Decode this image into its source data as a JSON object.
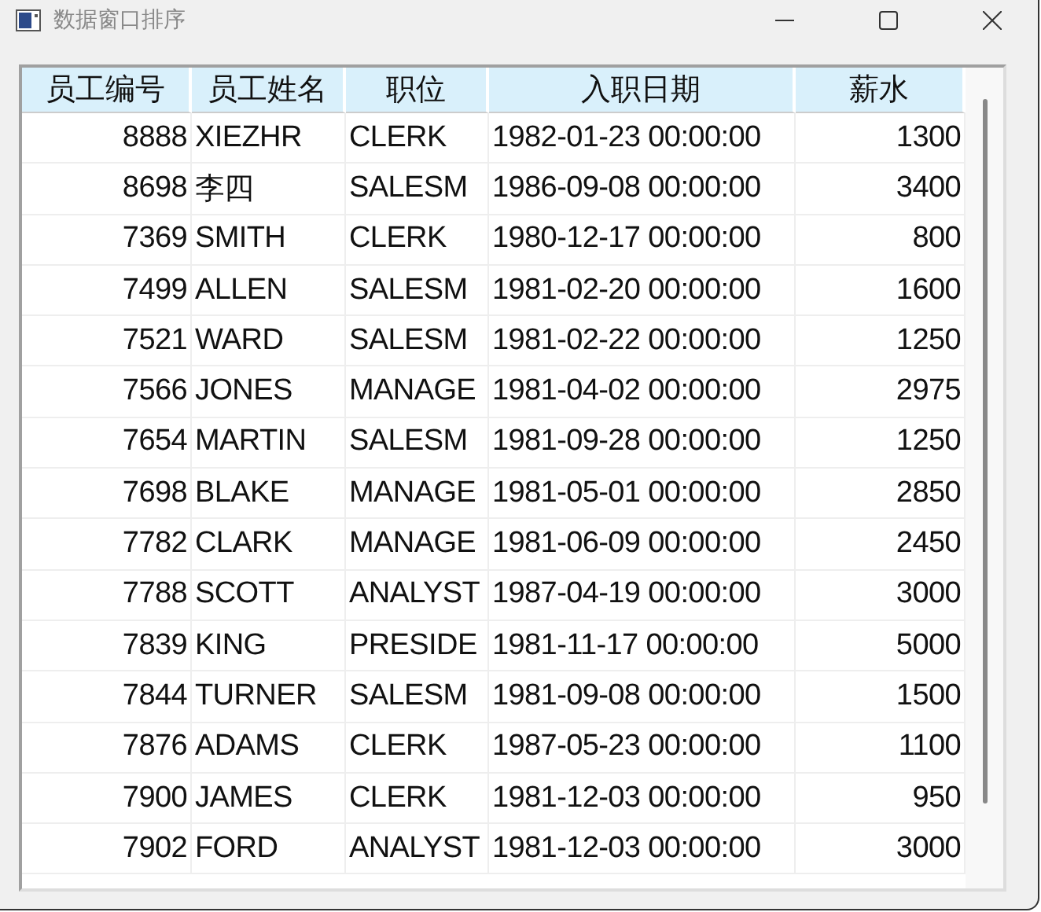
{
  "window": {
    "title": "数据窗口排序"
  },
  "table": {
    "columns": [
      "员工编号",
      "员工姓名",
      "职位",
      "入职日期",
      "薪水"
    ],
    "rows": [
      [
        "8888",
        "XIEZHR",
        "CLERK",
        "1982-01-23 00:00:00",
        "1300"
      ],
      [
        "8698",
        "李四",
        "SALESM",
        "1986-09-08 00:00:00",
        "3400"
      ],
      [
        "7369",
        "SMITH",
        "CLERK",
        "1980-12-17 00:00:00",
        "800"
      ],
      [
        "7499",
        "ALLEN",
        "SALESM",
        "1981-02-20 00:00:00",
        "1600"
      ],
      [
        "7521",
        "WARD",
        "SALESM",
        "1981-02-22 00:00:00",
        "1250"
      ],
      [
        "7566",
        "JONES",
        "MANAGE",
        "1981-04-02 00:00:00",
        "2975"
      ],
      [
        "7654",
        "MARTIN",
        "SALESM",
        "1981-09-28 00:00:00",
        "1250"
      ],
      [
        "7698",
        "BLAKE",
        "MANAGE",
        "1981-05-01 00:00:00",
        "2850"
      ],
      [
        "7782",
        "CLARK",
        "MANAGE",
        "1981-06-09 00:00:00",
        "2450"
      ],
      [
        "7788",
        "SCOTT",
        "ANALYST",
        "1987-04-19 00:00:00",
        "3000"
      ],
      [
        "7839",
        "KING",
        "PRESIDE",
        "1981-11-17 00:00:00",
        "5000"
      ],
      [
        "7844",
        "TURNER",
        "SALESM",
        "1981-09-08 00:00:00",
        "1500"
      ],
      [
        "7876",
        "ADAMS",
        "CLERK",
        "1987-05-23 00:00:00",
        "1100"
      ],
      [
        "7900",
        "JAMES",
        "CLERK",
        "1981-12-03 00:00:00",
        "950"
      ],
      [
        "7902",
        "FORD",
        "ANALYST",
        "1981-12-03 00:00:00",
        "3000"
      ]
    ]
  }
}
